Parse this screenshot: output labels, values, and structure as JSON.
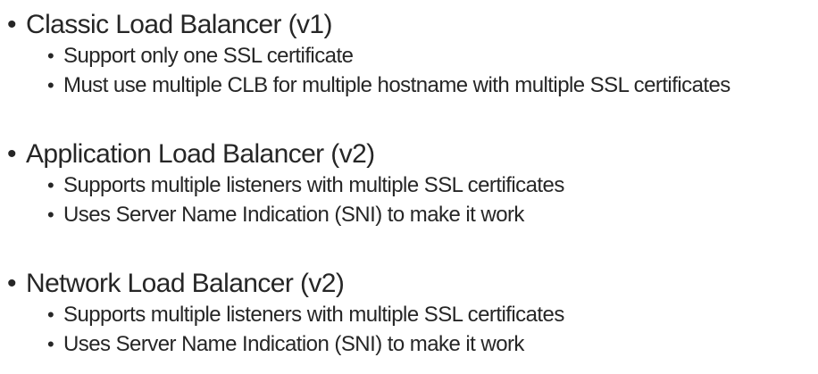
{
  "bullet_glyph": "•",
  "sections": [
    {
      "heading": "Classic Load Balancer (v1)",
      "items": [
        "Support only one SSL certificate",
        "Must use multiple CLB for multiple hostname with multiple SSL certificates"
      ]
    },
    {
      "heading": "Application Load Balancer (v2)",
      "items": [
        "Supports multiple listeners with multiple SSL certificates",
        "Uses Server Name Indication (SNI) to make it work"
      ]
    },
    {
      "heading": "Network Load Balancer (v2)",
      "items": [
        "Supports multiple listeners with multiple SSL certificates",
        "Uses Server Name Indication (SNI) to make it work"
      ]
    }
  ]
}
